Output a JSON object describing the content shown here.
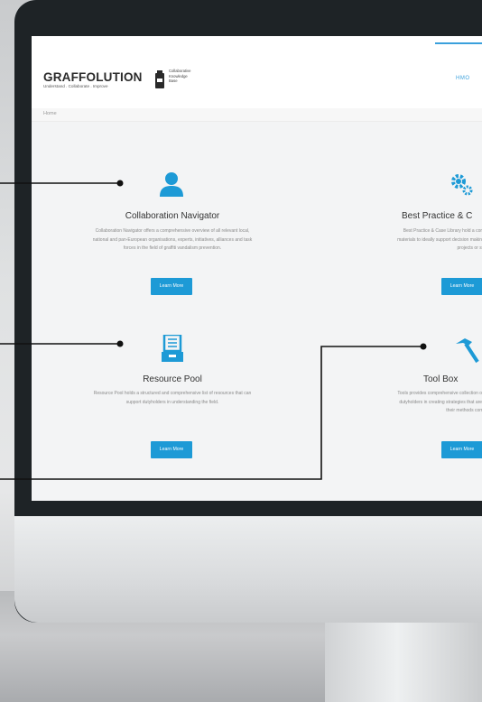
{
  "brand": {
    "name": "GRAFFOLUTION",
    "tagline": "Understand . Collaborate . Improve",
    "side_lines": [
      "Collaborative",
      "Knowledge",
      "Base"
    ]
  },
  "nav": {
    "active_label": "HMO"
  },
  "breadcrumb": {
    "home": "Home"
  },
  "cards": [
    {
      "title": "Collaboration Navigator",
      "desc_lines": [
        "Collaboration Navigator offers a comprehensive overview of all relevant local,",
        "national and pan-European organisations, experts, initiatives, alliances and task",
        "forces in the field of graffiti vandalism prevention."
      ],
      "button": "Learn More",
      "icon": "user-icon"
    },
    {
      "title": "Best Practice & C",
      "desc_lines": [
        "Best Practice & Case Library hold a compr",
        "materials to ideally support decision making p",
        "projects or strat"
      ],
      "button": "Learn More",
      "icon": "gears-icon"
    },
    {
      "title": "Resource Pool",
      "desc_lines": [
        "Resource Pool holds a structured and comprehensive list of resources that can",
        "support dutyholders in understanding the field."
      ],
      "button": "Learn More",
      "icon": "archive-icon"
    },
    {
      "title": "Tool Box",
      "desc_lines": [
        "Tools provides comprehensive collection of to",
        "dutyholders in creating strategies that are rel",
        "their methods compa"
      ],
      "button": "Learn More",
      "icon": "hammer-icon"
    }
  ],
  "colors": {
    "accent": "#1d9ad6",
    "monitor": "#1e2326"
  }
}
